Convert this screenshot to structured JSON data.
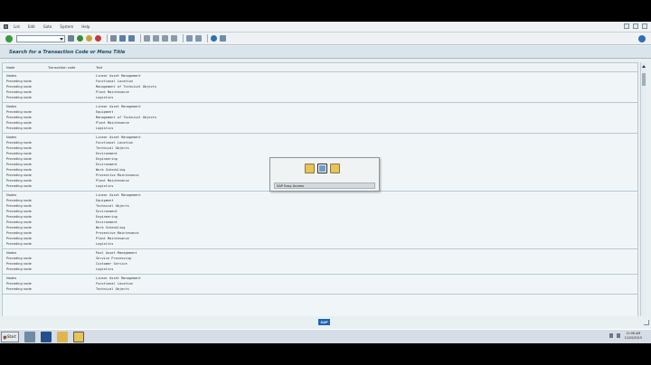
{
  "menubar": {
    "items": [
      "List",
      "Edit",
      "Goto",
      "System",
      "Help"
    ]
  },
  "toolbar": {
    "command_field_value": "",
    "icons": [
      "enter-icon",
      "back-icon",
      "exit-icon",
      "cancel-icon",
      "print-icon",
      "find-icon",
      "find-next-icon",
      "first-page-icon",
      "previous-page-icon",
      "next-page-icon",
      "last-page-icon",
      "new-session-icon",
      "shortcut-icon",
      "help-icon",
      "layout-icon"
    ]
  },
  "title": "Search for a Transaction Code or Menu Title",
  "table": {
    "headers": [
      "Node",
      "Transaction code",
      "Text"
    ],
    "groups": [
      {
        "rows": [
          {
            "node": "Nodes",
            "tcode": "",
            "text": "Linear Asset Management"
          },
          {
            "node": "Preceding node",
            "tcode": "",
            "text": "Functional Location"
          },
          {
            "node": "Preceding node",
            "tcode": "",
            "text": "Management of Technical Objects"
          },
          {
            "node": "Preceding node",
            "tcode": "",
            "text": "Plant Maintenance"
          },
          {
            "node": "Preceding node",
            "tcode": "",
            "text": "Logistics"
          }
        ]
      },
      {
        "rows": [
          {
            "node": "Nodes",
            "tcode": "",
            "text": "Linear Asset Management"
          },
          {
            "node": "Preceding node",
            "tcode": "",
            "text": "Equipment"
          },
          {
            "node": "Preceding node",
            "tcode": "",
            "text": "Management of Technical Objects"
          },
          {
            "node": "Preceding node",
            "tcode": "",
            "text": "Plant Maintenance"
          },
          {
            "node": "Preceding node",
            "tcode": "",
            "text": "Logistics"
          }
        ]
      },
      {
        "rows": [
          {
            "node": "Nodes",
            "tcode": "",
            "text": "Linear Asset Management"
          },
          {
            "node": "Preceding node",
            "tcode": "",
            "text": "Functional Location"
          },
          {
            "node": "Preceding node",
            "tcode": "",
            "text": "Technical Objects"
          },
          {
            "node": "Preceding node",
            "tcode": "",
            "text": "Environment"
          },
          {
            "node": "Preceding node",
            "tcode": "",
            "text": "Engineering"
          },
          {
            "node": "Preceding node",
            "tcode": "",
            "text": "Environment"
          },
          {
            "node": "Preceding node",
            "tcode": "",
            "text": "Work Scheduling"
          },
          {
            "node": "Preceding node",
            "tcode": "",
            "text": "Preventive Maintenance"
          },
          {
            "node": "Preceding node",
            "tcode": "",
            "text": "Plant Maintenance"
          },
          {
            "node": "Preceding node",
            "tcode": "",
            "text": "Logistics"
          }
        ]
      },
      {
        "rows": [
          {
            "node": "Nodes",
            "tcode": "",
            "text": "Linear Asset Management"
          },
          {
            "node": "Preceding node",
            "tcode": "",
            "text": "Equipment"
          },
          {
            "node": "Preceding node",
            "tcode": "",
            "text": "Technical Objects"
          },
          {
            "node": "Preceding node",
            "tcode": "",
            "text": "Environment"
          },
          {
            "node": "Preceding node",
            "tcode": "",
            "text": "Engineering"
          },
          {
            "node": "Preceding node",
            "tcode": "",
            "text": "Environment"
          },
          {
            "node": "Preceding node",
            "tcode": "",
            "text": "Work Scheduling"
          },
          {
            "node": "Preceding node",
            "tcode": "",
            "text": "Preventive Maintenance"
          },
          {
            "node": "Preceding node",
            "tcode": "",
            "text": "Plant Maintenance"
          },
          {
            "node": "Preceding node",
            "tcode": "",
            "text": "Logistics"
          }
        ]
      },
      {
        "rows": [
          {
            "node": "Nodes",
            "tcode": "",
            "text": "Pool Asset Management"
          },
          {
            "node": "Preceding node",
            "tcode": "",
            "text": "Service Processing"
          },
          {
            "node": "Preceding node",
            "tcode": "",
            "text": "Customer Service"
          },
          {
            "node": "Preceding node",
            "tcode": "",
            "text": "Logistics"
          }
        ]
      },
      {
        "rows": [
          {
            "node": "Nodes",
            "tcode": "",
            "text": "Linear Asset Management"
          },
          {
            "node": "Preceding node",
            "tcode": "",
            "text": "Functional Location"
          },
          {
            "node": "Preceding node",
            "tcode": "",
            "text": "Technical Objects"
          }
        ]
      }
    ]
  },
  "popup": {
    "label": "SAP Easy Access",
    "icons": [
      "window-icon",
      "sap-easy-access-icon",
      "folder-icon"
    ]
  },
  "status": {
    "logo_text": "SAP"
  },
  "taskbar": {
    "start_label": "Start",
    "apps": [
      "server-manager-icon",
      "powershell-icon",
      "explorer-icon",
      "sap-logon-icon"
    ],
    "clock_time": "12:08 AM",
    "clock_date": "12/20/2015"
  },
  "colors": {
    "content_bg": "#f0f6f8",
    "title_text": "#1f4a66",
    "sap_blue": "#1c64b4"
  }
}
